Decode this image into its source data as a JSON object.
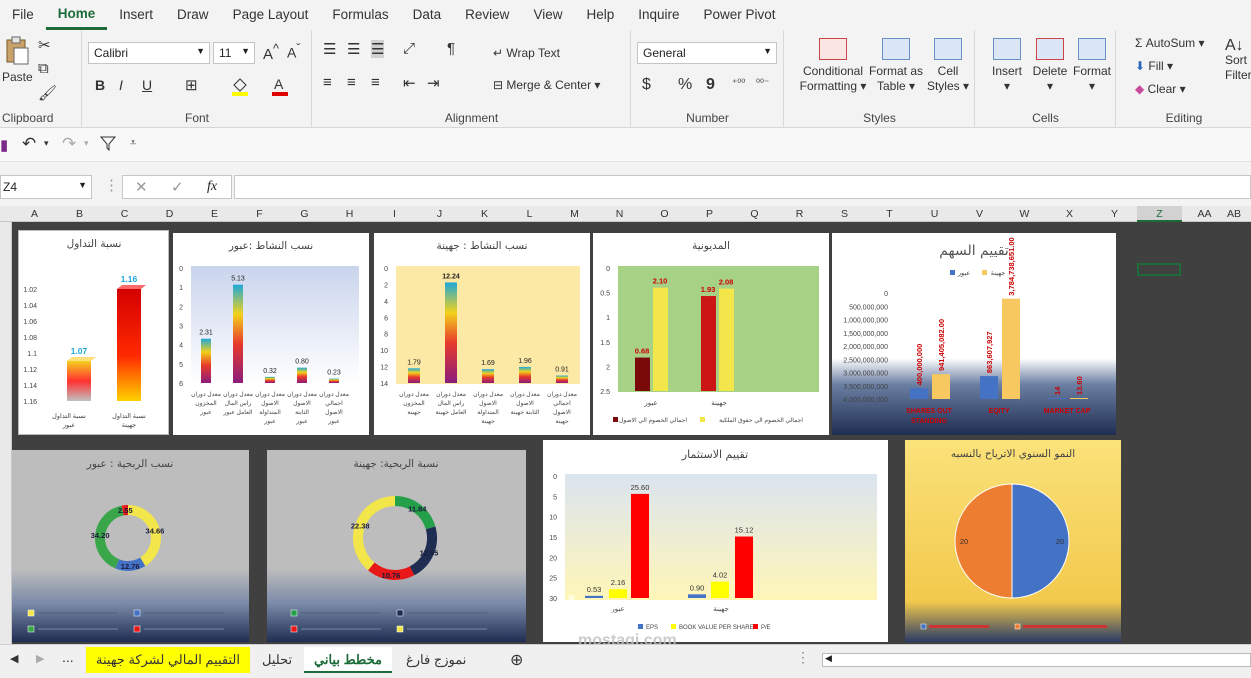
{
  "menu": [
    "File",
    "Home",
    "Insert",
    "Draw",
    "Page Layout",
    "Formulas",
    "Data",
    "Review",
    "View",
    "Help",
    "Inquire",
    "Power Pivot"
  ],
  "menu_active": "Home",
  "ribbon": {
    "clipboard": {
      "paste": "Paste",
      "label": "Clipboard"
    },
    "font": {
      "name": "Calibri",
      "size": "11",
      "label": "Font",
      "bold": "B",
      "italic": "I",
      "underline": "U"
    },
    "alignment": {
      "wrap": "Wrap Text",
      "merge": "Merge & Center",
      "label": "Alignment"
    },
    "number": {
      "format": "General",
      "label": "Number",
      "currency": "$",
      "percent": "%",
      "comma": "9"
    },
    "styles": {
      "conditional": "Conditional",
      "conditional2": "Formatting",
      "format_as": "Format as",
      "format_as2": "Table",
      "cell_styles": "Cell",
      "cell_styles2": "Styles",
      "label": "Styles"
    },
    "cells": {
      "insert": "Insert",
      "delete": "Delete",
      "format": "Format",
      "label": "Cells"
    },
    "editing": {
      "autosum": "AutoSum",
      "fill": "Fill",
      "clear": "Clear",
      "sort": "Sort",
      "filter": "Filter",
      "label": "Editing"
    }
  },
  "formula_bar": {
    "name_box": "Z4",
    "fx": "fx",
    "value": ""
  },
  "columns": [
    "A",
    "B",
    "C",
    "D",
    "E",
    "F",
    "G",
    "H",
    "I",
    "J",
    "K",
    "L",
    "M",
    "N",
    "O",
    "P",
    "Q",
    "R",
    "S",
    "T",
    "U",
    "V",
    "W",
    "X",
    "Y",
    "Z",
    "AA",
    "AB"
  ],
  "selected_column": "Z",
  "charts": {
    "c1": {
      "title": "نسبة التداول",
      "yticks": [
        "1.16",
        "1.14",
        "1.12",
        "1.1",
        "1.08",
        "1.06",
        "1.04",
        "1.02"
      ],
      "categories": [
        "نسبة التداول عبور",
        "نسبة التداول جهينة"
      ],
      "values": [
        "1.07",
        "1.16"
      ]
    },
    "c2": {
      "title": "نسب النشاط :عبور",
      "yticks": [
        "6",
        "5",
        "4",
        "3",
        "2",
        "1",
        "0"
      ],
      "values": [
        "2.31",
        "5.13",
        "0.32",
        "0.80",
        "0.23"
      ],
      "categories": [
        "معدل دوران المخزون عبور",
        "معدل دوران راس المال العامل عبور",
        "معدل دوران الاصول المتداولة عبور",
        "معدل دوران الاصول الثابتة عبور",
        "اجمالي الاصول عبور"
      ]
    },
    "c3": {
      "title": "نسب النشاط : جهينة",
      "yticks": [
        "14",
        "12",
        "10",
        "8",
        "6",
        "4",
        "2",
        "0"
      ],
      "values": [
        "1.79",
        "12.24",
        "1.69",
        "1.96",
        "0.91"
      ],
      "categories": [
        "معدل دوران المخزون جهينة",
        "معدل دوران راس المال العامل جهينة",
        "معدل دوران الاصول المتداولة جهينة",
        "معدل دوران الاصول الثابتة جهينة",
        "معدل دوران اجمالي الاصول جهينة"
      ]
    },
    "c4": {
      "title": "المديونية",
      "yticks": [
        "2.5",
        "2",
        "1.5",
        "1",
        "0.5",
        "0"
      ],
      "values": [
        "0.68",
        "2.10",
        "1.93",
        "2.08"
      ],
      "categories": [
        "عبور",
        "جهينة"
      ],
      "legend": [
        "اجمالي الخصوم الي الاصول",
        "اجمالي الخصوم الي حقوق الملكية"
      ]
    },
    "c5": {
      "title": "تقييم السهم",
      "legend": [
        "جهينة",
        "عبور"
      ],
      "yticks": [
        "4,000,000,000",
        "3,500,000,000",
        "3,000,000,000",
        "2,500,000,000",
        "2,000,000,000",
        "1,500,000,000",
        "1,000,000,000",
        "500,000,000",
        "0"
      ],
      "values": [
        "400,000,000",
        "941,405,082.00",
        "863,607,927",
        "3,784,738,651.00",
        "14",
        "13.60"
      ],
      "categories": [
        "SHARES OUT STANDING",
        "EQITY",
        "MARKET CAP"
      ]
    },
    "c6": {
      "title": "نسب الربحية : عبور",
      "labels": [
        "34.66",
        "12.76",
        "34.20",
        "2.55"
      ]
    },
    "c7": {
      "title": "نسبة الربحية: جهينة",
      "labels": [
        "11.84",
        "12.55",
        "10.76",
        "22.38"
      ]
    },
    "c8": {
      "title": "تقييم الاستثمار",
      "yticks": [
        "30",
        "25",
        "20",
        "15",
        "10",
        "5",
        "0"
      ],
      "categories": [
        "عبور",
        "جهينة"
      ],
      "values": [
        "0.53",
        "2.16",
        "25.60",
        "0.90",
        "4.02",
        "15.12"
      ],
      "legend": [
        "EPS",
        "BOOK VALUE PER SHARES",
        "P/E"
      ]
    },
    "c9": {
      "title": "النمو السنوي الاترباح بالنسبه",
      "labels": [
        "20",
        "20"
      ]
    }
  },
  "chart_data": [
    {
      "type": "bar",
      "title": "نسبة التداول",
      "categories": [
        "نسبة التداول عبور",
        "نسبة التداول جهينة"
      ],
      "values": [
        1.07,
        1.16
      ],
      "ylim": [
        1.02,
        1.16
      ]
    },
    {
      "type": "bar",
      "title": "نسب النشاط :عبور",
      "categories": [
        "معدل دوران المخزون عبور",
        "معدل دوران راس المال العامل عبور",
        "معدل دوران الاصول المتداولة عبور",
        "معدل دوران الاصول الثابتة عبور",
        "اجمالي الاصول عبور"
      ],
      "values": [
        2.31,
        5.13,
        0.32,
        0.8,
        0.23
      ],
      "ylim": [
        0,
        6
      ]
    },
    {
      "type": "bar",
      "title": "نسب النشاط : جهينة",
      "categories": [
        "معدل دوران المخزون جهينة",
        "معدل دوران راس المال العامل جهينة",
        "معدل دوران الاصول المتداولة جهينة",
        "معدل دوران الاصول الثابتة جهينة",
        "معدل دوران اجمالي الاصول جهينة"
      ],
      "values": [
        1.79,
        12.24,
        1.69,
        1.96,
        0.91
      ],
      "ylim": [
        0,
        14
      ]
    },
    {
      "type": "bar",
      "title": "المديونية",
      "categories": [
        "عبور",
        "جهينة"
      ],
      "series": [
        {
          "name": "اجمالي الخصوم الي الاصول",
          "values": [
            0.68,
            1.93
          ]
        },
        {
          "name": "اجمالي الخصوم الي حقوق الملكية",
          "values": [
            2.1,
            2.08
          ]
        }
      ],
      "ylim": [
        0,
        2.5
      ]
    },
    {
      "type": "bar",
      "title": "تقييم السهم",
      "categories": [
        "SHARES OUT STANDING",
        "EQITY",
        "MARKET CAP"
      ],
      "series": [
        {
          "name": "عبور",
          "values": [
            400000000,
            863607927,
            14
          ]
        },
        {
          "name": "جهينة",
          "values": [
            941405082,
            3784738651,
            13.6
          ]
        }
      ],
      "ylim": [
        0,
        4000000000
      ]
    },
    {
      "type": "pie",
      "title": "نسب الربحية : عبور",
      "values": [
        34.66,
        12.76,
        34.2,
        2.55
      ]
    },
    {
      "type": "pie",
      "title": "نسبة الربحية: جهينة",
      "values": [
        11.84,
        12.55,
        10.76,
        22.38
      ]
    },
    {
      "type": "bar",
      "title": "تقييم الاستثمار",
      "categories": [
        "عبور",
        "جهينة"
      ],
      "series": [
        {
          "name": "EPS",
          "values": [
            0.53,
            0.9
          ]
        },
        {
          "name": "BOOK VALUE PER SHARES",
          "values": [
            2.16,
            4.02
          ]
        },
        {
          "name": "P/E",
          "values": [
            25.6,
            15.12
          ]
        }
      ],
      "ylim": [
        0,
        30
      ]
    },
    {
      "type": "pie",
      "title": "النمو السنوي الاترباح بالنسبه",
      "values": [
        20,
        20
      ]
    }
  ],
  "tabs": [
    "التقييم المالي لشركة جهينة",
    "تحليل",
    "مخطط بياني",
    "نموزج فارغ"
  ],
  "active_tab": "مخطط بياني",
  "watermark": "mostaqi.com"
}
